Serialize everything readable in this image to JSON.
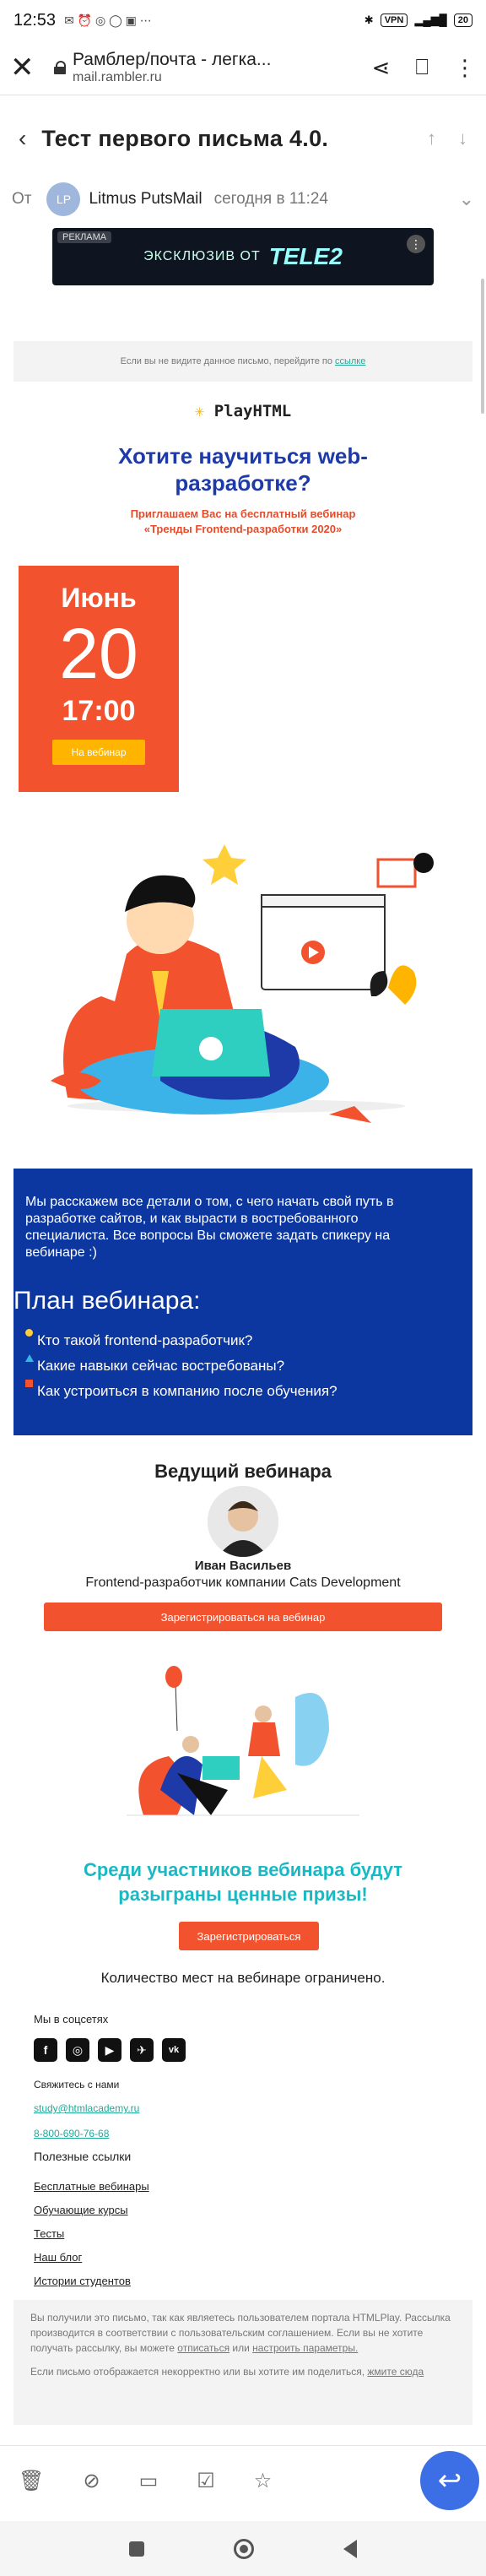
{
  "status": {
    "time": "12:53",
    "vpn": "VPN",
    "battery": "20"
  },
  "browser": {
    "title": "Рамблер/почта - легка...",
    "url": "mail.rambler.ru"
  },
  "mail": {
    "subject": "Тест первого письма 4.0.",
    "from_label": "От",
    "avatar": "LP",
    "sender": "Litmus PutsMail",
    "date": "сегодня в 11:24"
  },
  "ad": {
    "tag": "РЕКЛАМА",
    "text": "ЭКСКЛЮЗИВ ОТ",
    "brand": "TELE2"
  },
  "email": {
    "notice": "Если вы не видите данное письмо, перейдите по",
    "notice_link": "ссылке",
    "logo": "PlayHTML",
    "title": "Хотите научиться web-разработке?",
    "subtitle": "Приглашаем Вас на бесплатный вебинар «Тренды Frontend-разработки 2020»",
    "month": "Июнь",
    "day": "20",
    "time": "17:00",
    "cta_small": "На вебинар",
    "intro": "Мы расскажем все детали о том, с чего начать свой путь в разработке сайтов, и как вырасти в востребованного специалиста. Все вопросы Вы сможете задать спикеру на вебинаре :)",
    "plan_title": "План вебинара:",
    "plan_items": [
      "Кто такой frontend-разработчик?",
      "Какие навыки сейчас востребованы?",
      "Как устроиться в компанию после обучения?"
    ],
    "host_heading": "Ведущий вебинара",
    "host_name": "Иван Васильев",
    "host_role": "Frontend-разработчик компании Cats Development",
    "register_label": "Зарегистрироваться на вебинар",
    "prize": "Среди участников вебинара будут разыграны ценные призы!",
    "register2": "Зарегистрироваться",
    "limit": "Количество мест на вебинаре ограничено."
  },
  "footer": {
    "social_title": "Мы в соцсетях",
    "social": [
      "f",
      "◎",
      "▶",
      "✈",
      "vk"
    ],
    "contact_title": "Свяжитесь с нами",
    "email": "study@htmlacademy.ru",
    "phone": "8-800-690-76-68",
    "links_title": "Полезные ссылки",
    "links": [
      "Бесплатные вебинары",
      "Обучающие курсы",
      "Тесты",
      "Наш блог",
      "Истории студентов"
    ],
    "legal_p1": "Вы получили это письмо, так как являетесь пользователем портала HTMLPlay. Рассылка производится в соответствии с пользовательским соглашением. Если вы не хотите получать рассылку, вы можете",
    "legal_unsub": "отписаться",
    "legal_or": "или",
    "legal_settings": "настроить параметры.",
    "legal_p2": "Если письмо отображается некорректно или вы хотите им поделиться,",
    "legal_view": "жмите сюда"
  },
  "colors": {
    "accent": "#f2522e",
    "blue": "#0c36a0",
    "teal": "#19b9c4",
    "fab": "#3c6ee6"
  }
}
